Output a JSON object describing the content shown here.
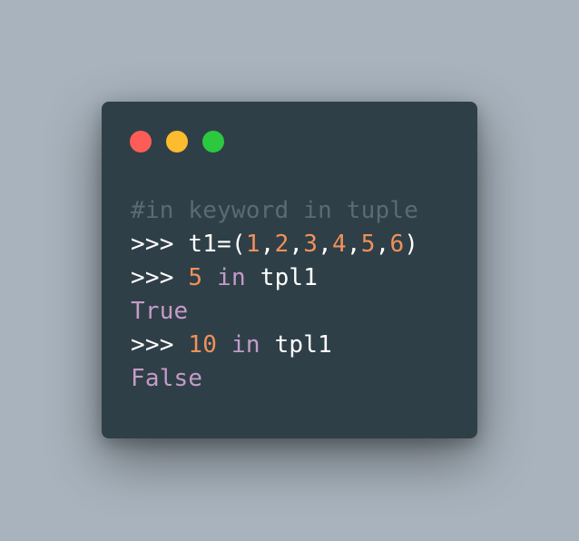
{
  "colors": {
    "background": "#a8b3bd",
    "window": "#2f3f47",
    "dot_red": "#fd5d56",
    "dot_yellow": "#fdbb2e",
    "dot_green": "#2bc840",
    "comment": "#5b6a73",
    "text": "#ffffff",
    "number": "#f0915b",
    "keyword": "#c49bc9"
  },
  "window_controls": [
    {
      "name": "close",
      "icon": "red-circle-icon"
    },
    {
      "name": "minimize",
      "icon": "yellow-circle-icon"
    },
    {
      "name": "maximize",
      "icon": "green-circle-icon"
    }
  ],
  "code": {
    "comment": "#in keyword in tuple",
    "line1": {
      "prompt": ">>> ",
      "t_head": "t1=(",
      "n1": "1",
      "c1": ",",
      "n2": "2",
      "c2": ",",
      "n3": "3",
      "c3": ",",
      "n4": "4",
      "c4": ",",
      "n5": "5",
      "c5": ",",
      "n6": "6",
      "close": ")"
    },
    "line2": {
      "prompt": ">>> ",
      "num": "5",
      "sp1": " ",
      "kw": "in",
      "rest": " tpl1"
    },
    "result1": "True",
    "line3": {
      "prompt": ">>> ",
      "num": "10",
      "sp1": " ",
      "kw": "in",
      "rest": " tpl1"
    },
    "result2": "False"
  }
}
